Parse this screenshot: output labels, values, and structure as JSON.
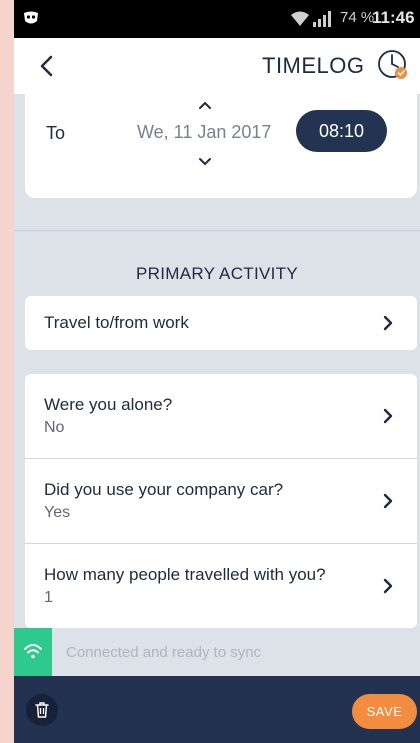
{
  "status_bar": {
    "battery": "74 %",
    "time": "11:46"
  },
  "app_bar": {
    "title": "TIMELOG"
  },
  "to_card": {
    "label": "To",
    "date": "We, 11 Jan 2017",
    "time": "08:10"
  },
  "primary_activity": {
    "heading": "PRIMARY ACTIVITY",
    "value": "Travel to/from work"
  },
  "questions": [
    {
      "question": "Were you alone?",
      "answer": "No"
    },
    {
      "question": "Did you use your company car?",
      "answer": "Yes"
    },
    {
      "question": "How many people travelled with you?",
      "answer": "1"
    }
  ],
  "sync_bar": {
    "message": "Connected and ready to sync"
  },
  "bottom_bar": {
    "save_label": "SAVE"
  },
  "colors": {
    "navy": "#223250",
    "accent": "#f28c3e",
    "sync_green": "#2ec98d"
  }
}
